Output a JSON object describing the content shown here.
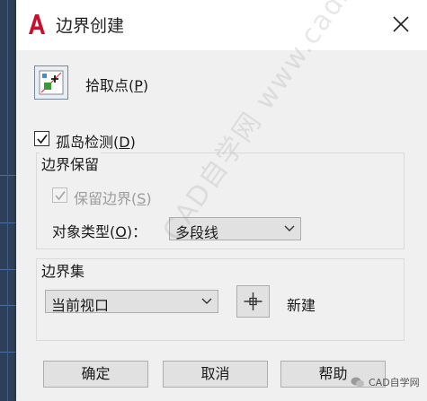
{
  "window": {
    "title": "边界创建"
  },
  "pick_points": {
    "label": "拾取点(",
    "key": "P",
    "suffix": ")"
  },
  "island_detection": {
    "label": "孤岛检测(",
    "key": "D",
    "suffix": ")",
    "checked": true
  },
  "boundary_retention": {
    "group_title": "边界保留",
    "retain_label": "保留边界(",
    "retain_key": "S",
    "retain_suffix": ")",
    "retain_checked": true,
    "retain_disabled": true,
    "object_type_label": "对象类型(",
    "object_type_key": "O",
    "object_type_suffix": ")：",
    "object_type_value": "多段线"
  },
  "boundary_set": {
    "group_title": "边界集",
    "selection_value": "当前视口",
    "new_label": "新建"
  },
  "buttons": {
    "ok": "确定",
    "cancel": "取消",
    "help": "帮助"
  },
  "watermark": {
    "corner_text": "CAD自学网",
    "diagonal_text": "CAD自学网 www.cadzxw.com"
  },
  "colors": {
    "accent_red": "#c8102e",
    "dialog_bg": "#f0f0f0"
  }
}
